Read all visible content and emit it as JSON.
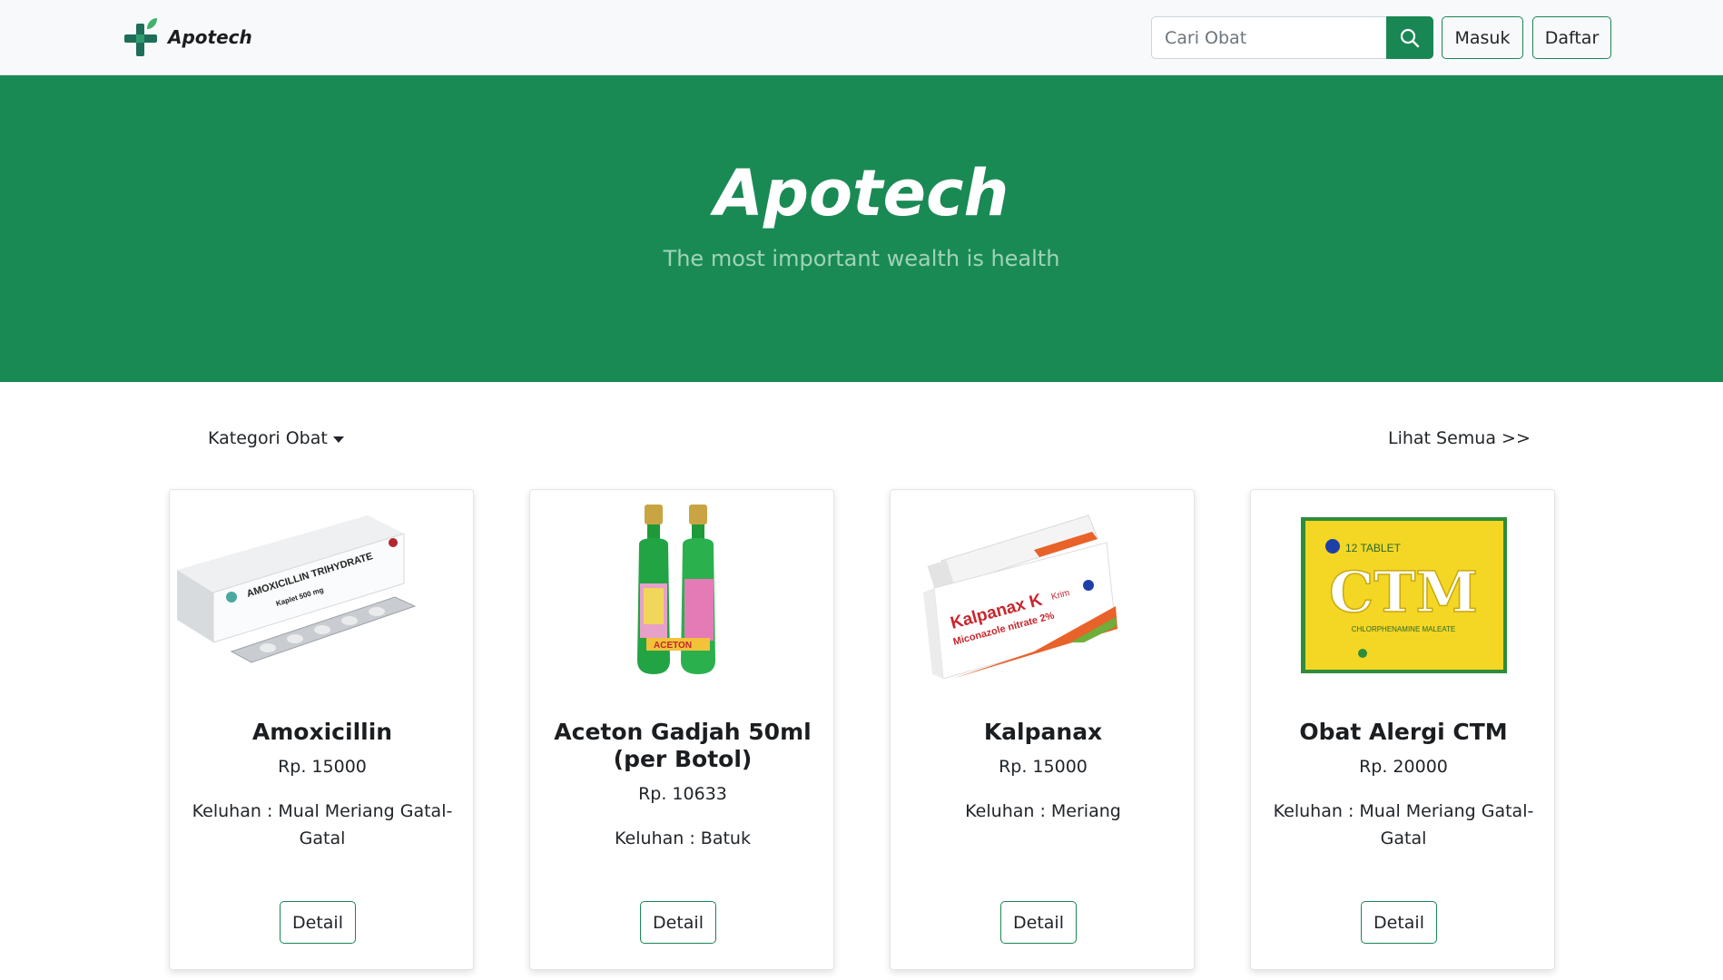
{
  "navbar": {
    "brand": "Apotech",
    "search_placeholder": "Cari Obat",
    "login_label": "Masuk",
    "register_label": "Daftar",
    "accent_color": "#198754"
  },
  "hero": {
    "title": "Apotech",
    "subtitle": "The most important wealth is health",
    "background_color": "#1a8a55"
  },
  "section": {
    "category_label": "Kategori Obat",
    "see_all_label": "Lihat Semua >>"
  },
  "products": [
    {
      "name": "Amoxicillin",
      "price": "Rp. 15000",
      "keluhan": "Keluhan : Mual Meriang Gatal-Gatal",
      "detail_label": "Detail",
      "image": "amoxicillin-box-image"
    },
    {
      "name": "Aceton Gadjah 50ml (per Botol)",
      "price": "Rp. 10633",
      "keluhan": "Keluhan : Batuk",
      "detail_label": "Detail",
      "image": "aceton-bottles-image"
    },
    {
      "name": "Kalpanax",
      "price": "Rp. 15000",
      "keluhan": "Keluhan : Meriang",
      "detail_label": "Detail",
      "image": "kalpanax-tube-image"
    },
    {
      "name": "Obat Alergi CTM",
      "price": "Rp. 20000",
      "keluhan": "Keluhan : Mual Meriang Gatal-Gatal",
      "detail_label": "Detail",
      "image": "ctm-box-image"
    }
  ],
  "image_text": {
    "amox_line1": "AMOXICILLIN TRIHYDRATE",
    "amox_line2": "Kaplet 500 mg",
    "aceton": "ACETON",
    "kalpanax_brand": "Kalpanax K",
    "kalpanax_krim": "Krim",
    "kalpanax_sub": "Miconazole nitrate 2%",
    "ctm_tablet": "12 TABLET",
    "ctm_big": "CTM",
    "ctm_sub": "CHLORPHENAMINE MALEATE"
  }
}
